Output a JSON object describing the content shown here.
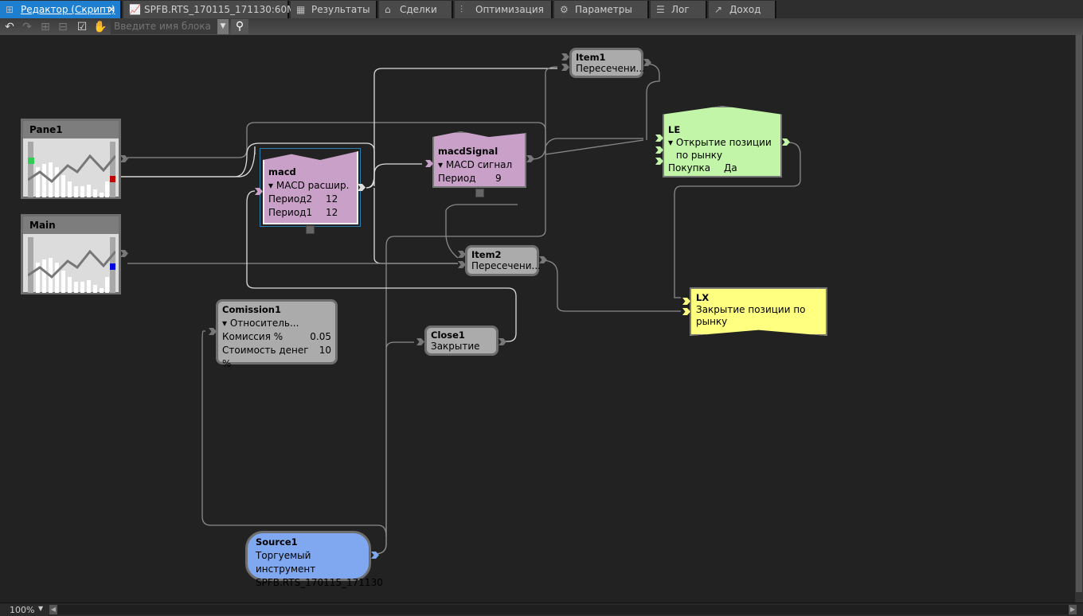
{
  "tabs": [
    {
      "label": "Редактор (Скрипт)",
      "icon": "diagram-icon",
      "active": true
    },
    {
      "label": "SPFB.RTS_170115_171130:60M",
      "icon": "chart-icon"
    },
    {
      "label": "Результаты",
      "icon": "grid-icon"
    },
    {
      "label": "Сделки",
      "icon": "bank-icon"
    },
    {
      "label": "Оптимизация",
      "icon": "sliders-icon"
    },
    {
      "label": "Параметры",
      "icon": "gear-icon"
    },
    {
      "label": "Лог",
      "icon": "list-icon"
    },
    {
      "label": "Доход",
      "icon": "profit-chart-icon"
    }
  ],
  "toolbar": {
    "search_placeholder": "Введите имя блока"
  },
  "nodes": {
    "pane1": {
      "title": "Pane1",
      "marker_colors": [
        "#2ecc55",
        "#c00000"
      ]
    },
    "main": {
      "title": "Main",
      "marker_colors": [
        "#0000e0"
      ]
    },
    "macd": {
      "title": "macd",
      "type": "MACD расшир.",
      "params": [
        {
          "name": "Период2",
          "value": "12"
        },
        {
          "name": "Период1",
          "value": "12"
        }
      ],
      "color": "#c8a0c8"
    },
    "macdSignal": {
      "title": "macdSignal",
      "type": "MACD сигнал",
      "params": [
        {
          "name": "Период",
          "value": "9"
        }
      ],
      "color": "#c8a0c8"
    },
    "item1": {
      "title": "Item1",
      "type": "Пересечени..."
    },
    "item2": {
      "title": "Item2",
      "type": "Пересечени..."
    },
    "le": {
      "title": "LE",
      "type": "Открытие позиции по рынку",
      "params": [
        {
          "name": "Покупка",
          "value": "Да"
        }
      ],
      "color": "#c3f5a8"
    },
    "lx": {
      "title": "LX",
      "type": "Закрытие позиции по рынку",
      "color": "#ffff80"
    },
    "comission": {
      "title": "Comission1",
      "type": "Относитель...",
      "params": [
        {
          "name": "Комиссия %",
          "value": "0.05"
        },
        {
          "name": "Стоимость денег %",
          "value": "10"
        }
      ]
    },
    "close": {
      "title": "Close1",
      "type": "Закрытие"
    },
    "source": {
      "title": "Source1",
      "type": "Торгуемый инструмент",
      "value": "SPFB.RTS_170115_171130",
      "color": "#7fa8f0"
    }
  },
  "status": {
    "zoom": "100%"
  }
}
